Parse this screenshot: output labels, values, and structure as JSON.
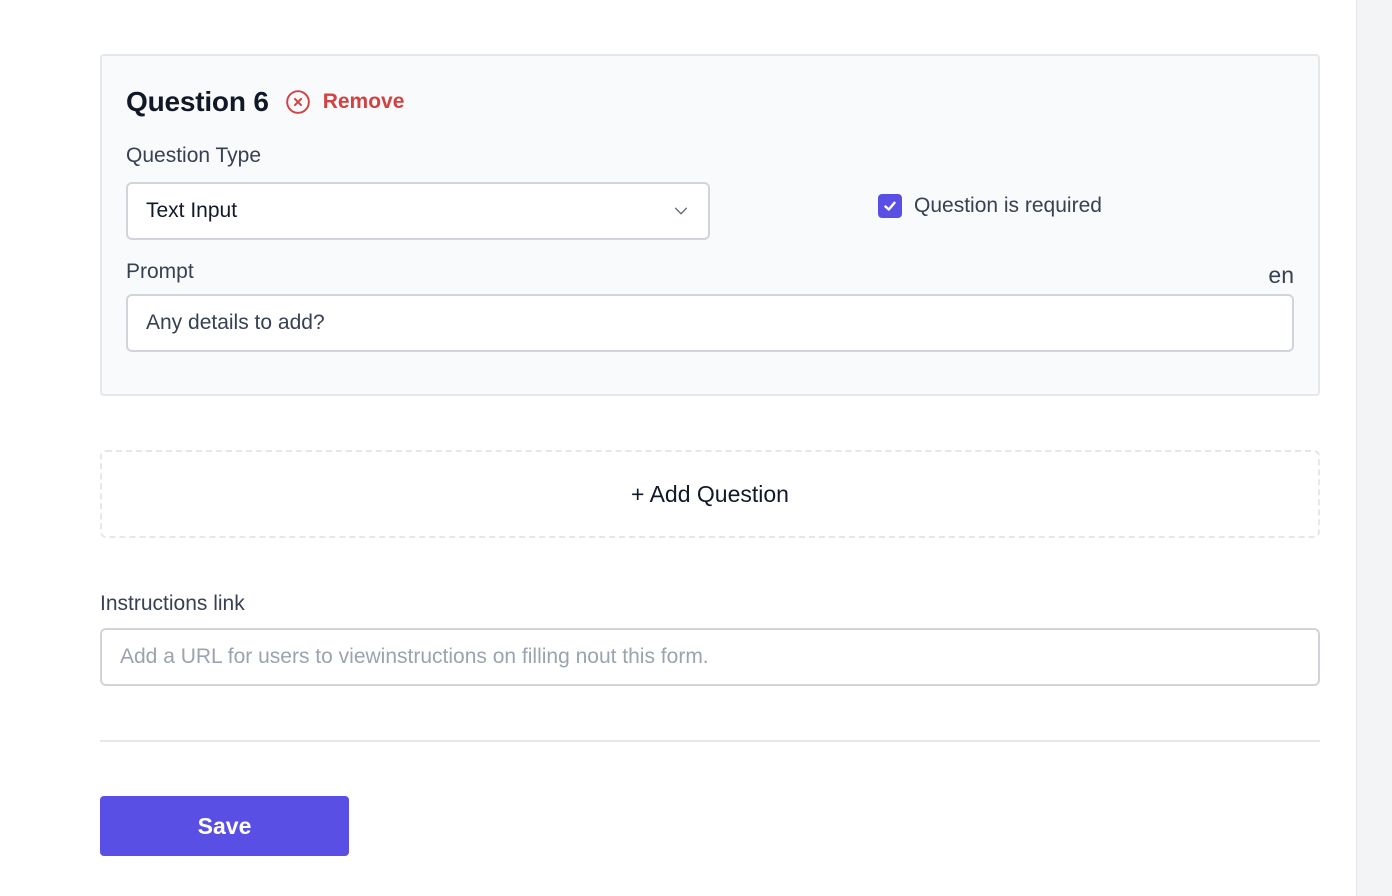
{
  "question": {
    "title": "Question 6",
    "remove_label": "Remove",
    "type_label": "Question Type",
    "type_value": "Text Input",
    "required_label": "Question is required",
    "required_checked": true,
    "prompt_label": "Prompt",
    "language": "en",
    "prompt_value": "Any details to add?"
  },
  "add_question_label": "+ Add Question",
  "instructions": {
    "label": "Instructions link",
    "placeholder": "Add a URL for users to viewinstructions on filling nout this form."
  },
  "save_label": "Save",
  "icons": {
    "remove": "x-circle-icon",
    "select": "chevron-down-icon",
    "checkbox": "check-icon"
  },
  "colors": {
    "accent": "#5a4fe5",
    "danger": "#d14343",
    "card_bg": "#f9fafb",
    "border": "#d1d5db"
  }
}
